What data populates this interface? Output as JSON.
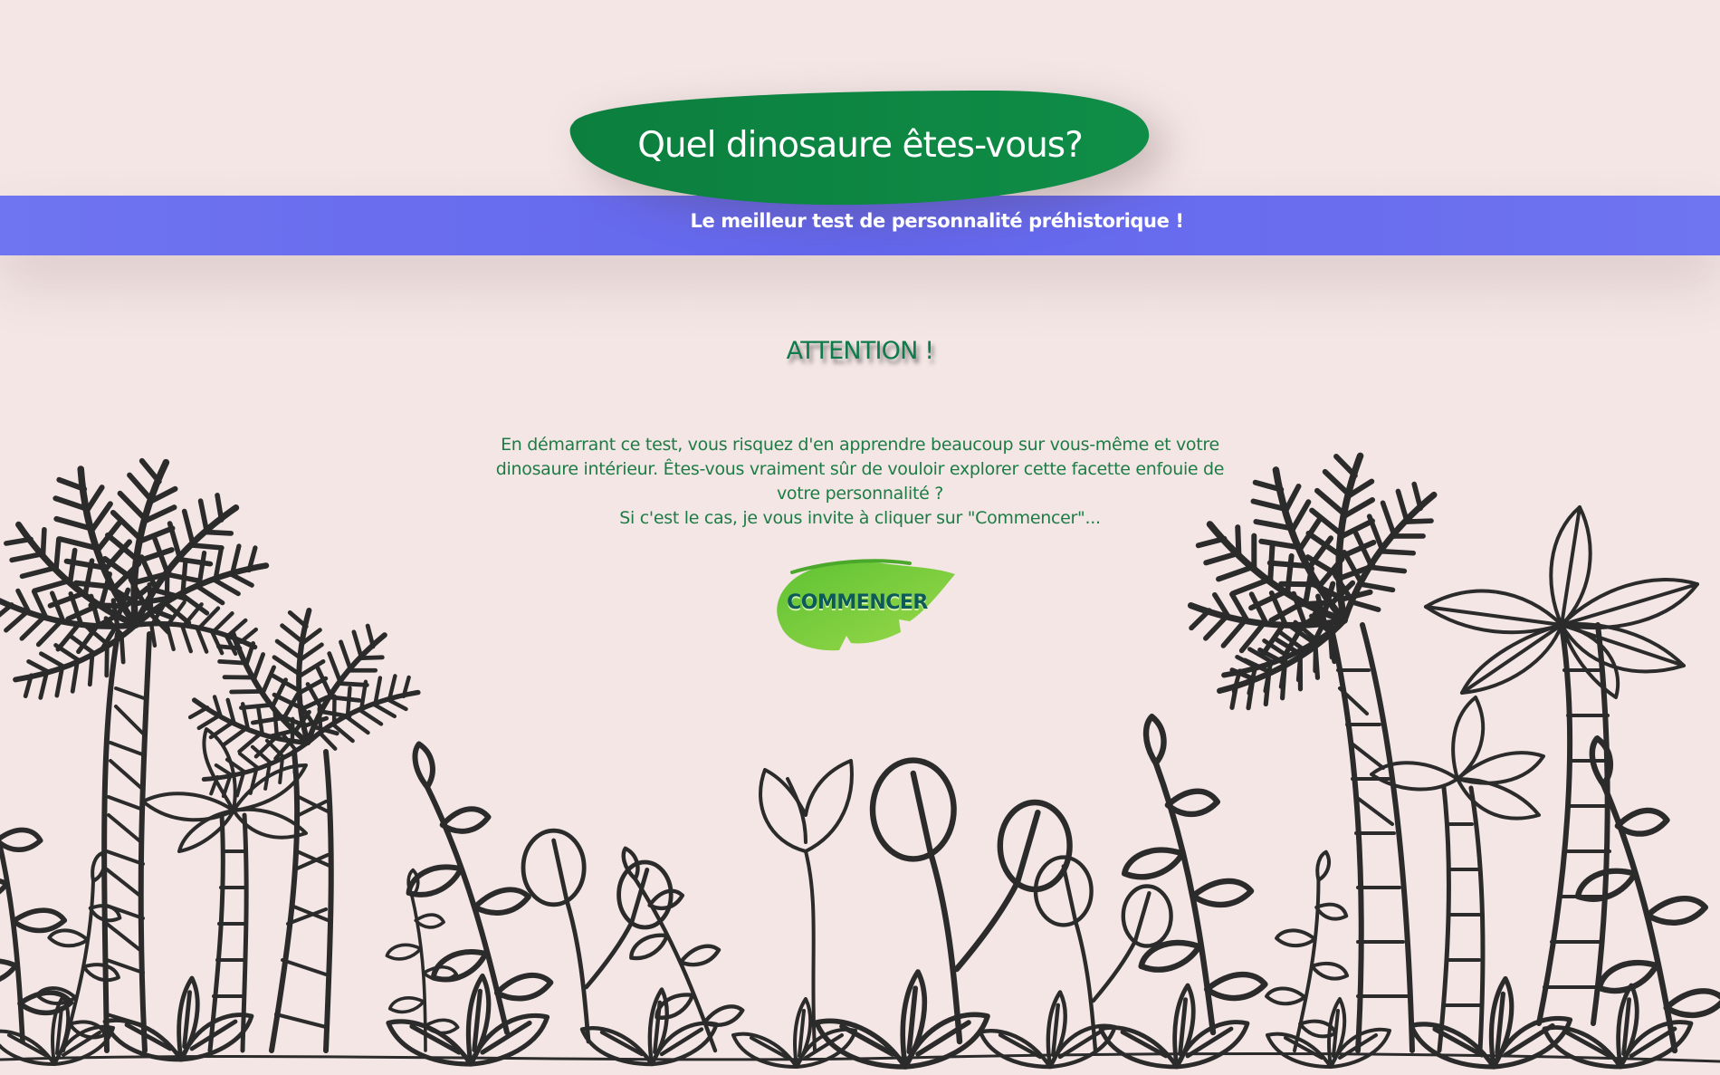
{
  "header": {
    "title": "Quel dinosaure êtes-vous?",
    "subtitle": "Le meilleur test de personnalité préhistorique !"
  },
  "warning": {
    "heading": "ATTENTION !",
    "paragraph_1": "En démarrant ce test, vous risquez d'en apprendre beaucoup sur vous-même et votre dinosaure intérieur. Êtes-vous vraiment sûr de vouloir explorer cette facette enfouie de votre personnalité ?",
    "paragraph_2": "Si c'est le cas, je vous invite à cliquer sur \"Commencer\"..."
  },
  "start_button": {
    "label": "COMMENCER"
  },
  "colors": {
    "background": "#f3e6e5",
    "band": "#6366ec",
    "title_leaf": "#0e8a44",
    "text_green": "#1d7c45",
    "button_leaf": "#7cd23a",
    "button_text": "#0c5a5a",
    "illustration_ink": "#2b2b2b"
  },
  "decoration": {
    "illustration": "jungle-palm-trees-sketch"
  }
}
